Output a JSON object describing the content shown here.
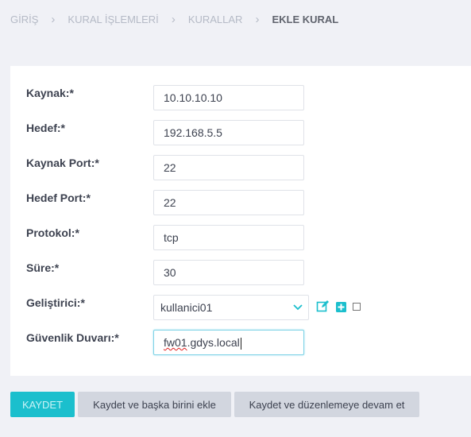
{
  "breadcrumb": {
    "items": [
      "GİRİŞ",
      "KURAL İŞLEMLERİ",
      "KURALLAR"
    ],
    "current": "EKLE KURAL"
  },
  "form": {
    "source": {
      "label": "Kaynak:*",
      "value": "10.10.10.10"
    },
    "destination": {
      "label": "Hedef:*",
      "value": "192.168.5.5"
    },
    "source_port": {
      "label": "Kaynak Port:*",
      "value": "22"
    },
    "destination_port": {
      "label": "Hedef Port:*",
      "value": "22"
    },
    "protocol": {
      "label": "Protokol:*",
      "value": "tcp"
    },
    "duration": {
      "label": "Süre:*",
      "value": "30"
    },
    "developer": {
      "label": "Geliştirici:*",
      "value": "kullanici01"
    },
    "firewall": {
      "label": "Güvenlik Duvarı:*",
      "value_misspelled_part": "fw01",
      "value_rest": ".gdys.local"
    }
  },
  "icons": {
    "edit": "edit-icon",
    "add": "add-icon",
    "accent": "#1bbfcd"
  },
  "buttons": {
    "save": "KAYDET",
    "save_add_another": "Kaydet ve başka birini ekle",
    "save_continue": "Kaydet ve düzenlemeye devam et"
  }
}
